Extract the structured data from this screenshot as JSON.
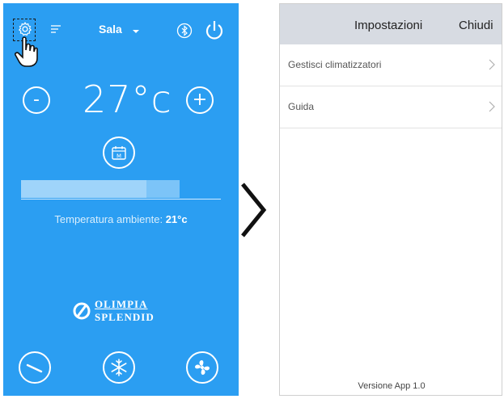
{
  "left_screen": {
    "room": "Sala",
    "temperature": "27°c",
    "minus_label": "-",
    "plus_label": "+",
    "bar_fill_fraction": 0.79,
    "ambient_prefix": "Temperatura ambiente:",
    "ambient_value": "21°c",
    "logo_line1": "OLIMPIA",
    "logo_line2": "SPLENDID",
    "colors": {
      "background": "#2b9ef2",
      "bar": "#9fd4fa"
    },
    "icons": [
      "gear-icon",
      "menu-icon",
      "bluetooth-icon",
      "power-icon",
      "hand-pointer-icon",
      "calendar-icon",
      "swing-icon",
      "snowflake-icon",
      "fan-icon"
    ]
  },
  "right_screen": {
    "title": "Impostazioni",
    "close_label": "Chiudi",
    "items": [
      {
        "label": "Gestisci climatizzatori"
      },
      {
        "label": "Guida"
      }
    ],
    "version": "Versione App 1.0",
    "colors": {
      "header": "#d7dbe2"
    }
  },
  "calendar_letter": "M"
}
